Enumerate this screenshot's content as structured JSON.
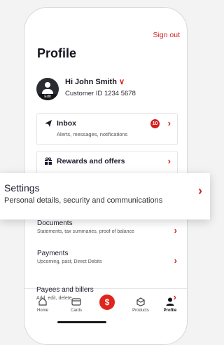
{
  "header": {
    "sign_out": "Sign out",
    "title": "Profile"
  },
  "user": {
    "greeting": "Hi John Smith",
    "customer_id": "Customer ID 1234 5678",
    "edit_label": "Edit"
  },
  "cards": {
    "inbox": {
      "label": "Inbox",
      "subtitle": "Alerts, messages, notifications",
      "badge": "10",
      "icon": "paper-plane-icon"
    },
    "rewards": {
      "label": "Rewards and offers",
      "icon": "gift-icon"
    }
  },
  "settings": {
    "label": "Settings",
    "subtitle": "Personal details, security and communications"
  },
  "rows": [
    {
      "label": "Documents",
      "subtitle": "Statements, tax summaries, proof of balance"
    },
    {
      "label": "Payments",
      "subtitle": "Upcoming, past, Direct Debits"
    },
    {
      "label": "Payees and billers",
      "subtitle": "Add, edit, delete"
    }
  ],
  "tabbar": {
    "home": "Home",
    "cards": "Cards",
    "pay": "$",
    "products": "Products",
    "profile": "Profile",
    "active": "Profile"
  },
  "colors": {
    "accent": "#d51f1f",
    "pay_button": "#e0251d"
  }
}
